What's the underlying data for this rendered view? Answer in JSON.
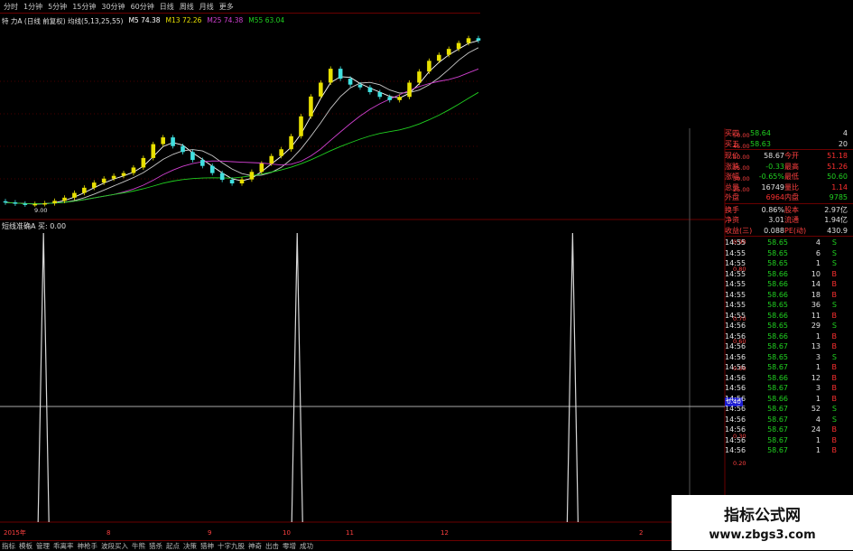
{
  "toolbar": {
    "tabs": [
      "分时",
      "1分钟",
      "5分钟",
      "15分钟",
      "30分钟",
      "60分钟",
      "日线",
      "周线",
      "月线",
      "更多"
    ]
  },
  "ma_line": {
    "label": "特 力A (日线 前复权) 均线(5,13,25,55)",
    "items": [
      {
        "text": "M5 74.38",
        "color": "#ffffff"
      },
      {
        "text": "M13 72.26",
        "color": "#e8e000"
      },
      {
        "text": "M25 74.38",
        "color": "#d040d0"
      },
      {
        "text": "M55 63.04",
        "color": "#20d020"
      }
    ]
  },
  "price_low_label": "9.00",
  "indicator_label": "短线准确A 买: 0.00",
  "y_axis_labels": [
    "50.00",
    "45.00",
    "40.00",
    "35.00",
    "30.00",
    "25.00"
  ],
  "sub_y_labels": [
    "0.90",
    "0.80",
    "0.70",
    "0.60",
    "0.50",
    "0.30",
    "0.20"
  ],
  "cursor_value": "0.40",
  "x_axis": [
    "2015年",
    "8",
    "9",
    "10",
    "11",
    "12",
    "2"
  ],
  "bottom_tabs": [
    "指标",
    "模板",
    "管理",
    "乖离率",
    "神枪手",
    "波段买入",
    "牛熊",
    "猎杀",
    "起点",
    "决策",
    "猎神",
    "十字九股",
    "神奇",
    "出击",
    "零增",
    "成功"
  ],
  "quote": {
    "book": [
      {
        "label": "买四",
        "price": "58.64",
        "vol": "4"
      },
      {
        "label": "买五",
        "price": "58.63",
        "vol": "20"
      }
    ],
    "stats": [
      {
        "l1": "现价",
        "v1": "58.67",
        "l2": "今开",
        "v2": "51.18"
      },
      {
        "l1": "涨跌",
        "v1": "-0.33",
        "l2": "最高",
        "v2": "51.26"
      },
      {
        "l1": "涨幅",
        "v1": "-0.65%",
        "l2": "最低",
        "v2": "50.60"
      },
      {
        "l1": "总量",
        "v1": "16749",
        "l2": "量比",
        "v2": "1.14"
      },
      {
        "l1": "外盘",
        "v1": "6964",
        "l2": "内盘",
        "v2": "9785"
      }
    ],
    "stats2": [
      {
        "l1": "换手",
        "v1": "0.86%",
        "l2": "股本",
        "v2": "2.97亿"
      },
      {
        "l1": "净资",
        "v1": "3.01",
        "l2": "流通",
        "v2": "1.94亿"
      },
      {
        "l1": "收益(三)",
        "v1": "0.088",
        "l2": "PE(动)",
        "v2": "430.9"
      }
    ],
    "ticks": [
      {
        "t": "14:55",
        "p": "58.65",
        "v": "4",
        "s": "S"
      },
      {
        "t": "14:55",
        "p": "58.65",
        "v": "6",
        "s": "S"
      },
      {
        "t": "14:55",
        "p": "58.65",
        "v": "1",
        "s": "S"
      },
      {
        "t": "14:55",
        "p": "58.66",
        "v": "10",
        "s": "B"
      },
      {
        "t": "14:55",
        "p": "58.66",
        "v": "14",
        "s": "B"
      },
      {
        "t": "14:55",
        "p": "58.66",
        "v": "18",
        "s": "B"
      },
      {
        "t": "14:55",
        "p": "58.65",
        "v": "36",
        "s": "S"
      },
      {
        "t": "14:55",
        "p": "58.66",
        "v": "11",
        "s": "B"
      },
      {
        "t": "14:56",
        "p": "58.65",
        "v": "29",
        "s": "S"
      },
      {
        "t": "14:56",
        "p": "58.66",
        "v": "1",
        "s": "B"
      },
      {
        "t": "14:56",
        "p": "58.67",
        "v": "13",
        "s": "B"
      },
      {
        "t": "14:56",
        "p": "58.65",
        "v": "3",
        "s": "S"
      },
      {
        "t": "14:56",
        "p": "58.67",
        "v": "1",
        "s": "B"
      },
      {
        "t": "14:56",
        "p": "58.66",
        "v": "12",
        "s": "B"
      },
      {
        "t": "14:56",
        "p": "58.67",
        "v": "3",
        "s": "B"
      },
      {
        "t": "14:56",
        "p": "58.66",
        "v": "1",
        "s": "B"
      },
      {
        "t": "14:56",
        "p": "58.67",
        "v": "52",
        "s": "S"
      },
      {
        "t": "14:56",
        "p": "58.67",
        "v": "4",
        "s": "S"
      },
      {
        "t": "14:56",
        "p": "58.67",
        "v": "24",
        "s": "B"
      },
      {
        "t": "14:56",
        "p": "58.67",
        "v": "1",
        "s": "B"
      },
      {
        "t": "14:56",
        "p": "58.67",
        "v": "1",
        "s": "B"
      }
    ]
  },
  "watermark": {
    "title": "指标公式网",
    "url": "www.zbgs3.com"
  },
  "colors": {
    "up": "#e8e000",
    "down": "#40e0e0",
    "sell": "#20d020",
    "buy": "#ff3030",
    "label": "#ff4040",
    "grid": "#6a0000"
  },
  "chart_data": {
    "type": "line",
    "title": "",
    "candles_close": [
      9.8,
      9.5,
      9.3,
      9.4,
      9.6,
      10.2,
      11.0,
      12.2,
      13.5,
      14.8,
      15.8,
      16.5,
      17.2,
      18.6,
      21.0,
      24.5,
      26.2,
      24.0,
      22.5,
      20.5,
      19.0,
      17.2,
      15.5,
      14.6,
      15.6,
      17.5,
      19.6,
      21.5,
      23.2,
      26.5,
      31.5,
      36.5,
      40.0,
      43.5,
      41.0,
      39.5,
      38.8,
      37.6,
      36.4,
      35.6,
      36.4,
      40.0,
      42.8,
      45.5,
      47.0,
      48.5,
      50.0,
      51.2,
      50.6
    ],
    "indicator_series": [
      {
        "name": "买",
        "x_positions": [
          0.06,
          0.41,
          0.79
        ],
        "values": [
          1,
          1,
          1
        ]
      }
    ],
    "ylim_indicator": [
      0,
      1
    ]
  }
}
